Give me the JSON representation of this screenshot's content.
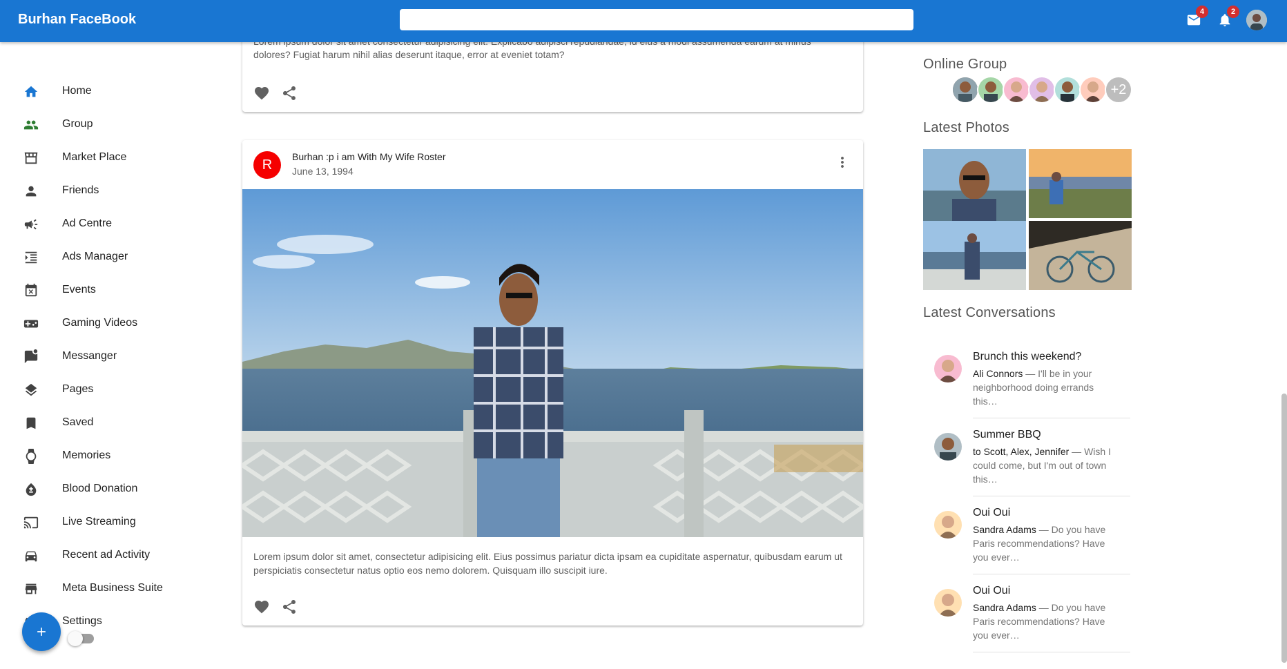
{
  "app": {
    "title": "Burhan FaceBook"
  },
  "header": {
    "search_value": "",
    "mail_badge": "4",
    "notification_badge": "2"
  },
  "sidebar": {
    "items": [
      {
        "label": "Home",
        "icon": "home-icon",
        "color": "#1976d2"
      },
      {
        "label": "Group",
        "icon": "group-icon",
        "color": "#2e7d32"
      },
      {
        "label": "Market Place",
        "icon": "storefront-icon",
        "color": "#424242"
      },
      {
        "label": "Friends",
        "icon": "person-icon",
        "color": "#424242"
      },
      {
        "label": "Ad Centre",
        "icon": "campaign-icon",
        "color": "#424242"
      },
      {
        "label": "Ads Manager",
        "icon": "format-indent-icon",
        "color": "#424242"
      },
      {
        "label": "Events",
        "icon": "event-busy-icon",
        "color": "#424242"
      },
      {
        "label": "Gaming Videos",
        "icon": "gamepad-icon",
        "color": "#424242"
      },
      {
        "label": "Messanger",
        "icon": "mark-chat-icon",
        "color": "#424242"
      },
      {
        "label": "Pages",
        "icon": "layers-icon",
        "color": "#424242"
      },
      {
        "label": "Saved",
        "icon": "bookmark-icon",
        "color": "#424242"
      },
      {
        "label": "Memories",
        "icon": "watch-icon",
        "color": "#424242"
      },
      {
        "label": "Blood Donation",
        "icon": "bloodtype-icon",
        "color": "#424242"
      },
      {
        "label": "Live Streaming",
        "icon": "cast-icon",
        "color": "#424242"
      },
      {
        "label": "Recent ad Activity",
        "icon": "car-icon",
        "color": "#424242"
      },
      {
        "label": "Meta Business Suite",
        "icon": "store-icon",
        "color": "#424242"
      },
      {
        "label": "Settings",
        "icon": "settings-icon",
        "color": "#424242"
      }
    ]
  },
  "feed": {
    "posts": [
      {
        "text_partial": "Lorem ipsum dolor sit amet consectetur adipisicing elit. Explicabo adipisci repudiandae, id eius a modi assumenda earum at minus",
        "text": "dolores? Fugiat harum nihil alias deserunt itaque, error at eveniet totam?"
      },
      {
        "avatar_letter": "R",
        "title": "Burhan :p i am With My Wife Roster",
        "date": "June 13, 1994",
        "text": "Lorem ipsum dolor sit amet, consectetur adipisicing elit. Eius possimus pariatur dicta ipsam ea cupiditate aspernatur, quibusdam earum ut perspiciatis consectetur natus optio eos nemo dolorem. Quisquam illo suscipit iure."
      }
    ]
  },
  "rightbar": {
    "online_group_title": "Online Group",
    "online_more": "+2",
    "latest_photos_title": "Latest Photos",
    "latest_conversations_title": "Latest Conversations",
    "conversations": [
      {
        "title": "Brunch this weekend?",
        "from": "Ali Connors",
        "snippet": " — I'll be in your neighborhood doing errands this…"
      },
      {
        "title": "Summer BBQ",
        "from": "to Scott, Alex, Jennifer",
        "snippet": " — Wish I could come, but I'm out of town this…"
      },
      {
        "title": "Oui Oui",
        "from": "Sandra Adams",
        "snippet": " — Do you have Paris recommendations? Have you ever…"
      },
      {
        "title": "Oui Oui",
        "from": "Sandra Adams",
        "snippet": " — Do you have Paris recommendations? Have you ever…"
      }
    ]
  },
  "colors": {
    "appbar": "#1976d2",
    "post_avatar": "#f50000",
    "badge": "#d32f2f"
  }
}
